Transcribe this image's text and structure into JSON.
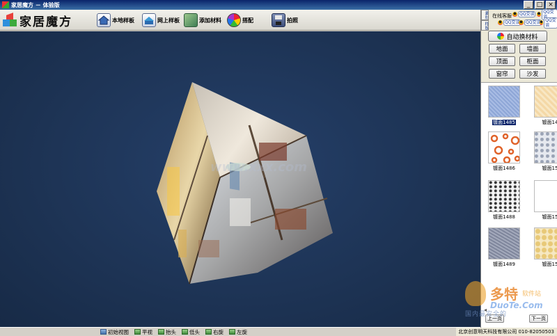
{
  "window": {
    "title": "家居魔方 － 体验版",
    "controls": [
      "_",
      "□",
      "×"
    ]
  },
  "toolbar": {
    "logo_text": "家居魔方",
    "buttons": [
      "本地样板",
      "网上样板",
      "添加材料",
      "搭配",
      "拍照"
    ]
  },
  "viewport": {
    "watermark": "www.xxx.com"
  },
  "bottombar": {
    "views": [
      "初始视图",
      "平视",
      "抬头",
      "低头",
      "右旋",
      "左旋"
    ]
  },
  "panel": {
    "vtabs": [
      "素材",
      "样板"
    ],
    "service_label": "在线客服",
    "qq_label": "QQ交谈",
    "auto_button": "自动换材料",
    "material_buttons": [
      "地面",
      "墙面",
      "顶面",
      "柜面",
      "窗帘",
      "沙发"
    ],
    "swatches": [
      {
        "label": "镀面1485",
        "selected": true,
        "color": "#8ea6d6"
      },
      {
        "label": "镀面14",
        "selected": false,
        "color": "#f4d8a6"
      },
      {
        "label": "镀面1486",
        "selected": false,
        "color": "#ffffff"
      },
      {
        "label": "镀面15",
        "selected": false,
        "color": "#dfe3ea"
      },
      {
        "label": "镀面1488",
        "selected": false,
        "color": "#f2f2f2"
      },
      {
        "label": "镀面15",
        "selected": false,
        "color": "#ffffff"
      },
      {
        "label": "镀面1489",
        "selected": false,
        "color": "#8d93a8"
      },
      {
        "label": "镀面15",
        "selected": false,
        "color": "#f3e1b0"
      }
    ],
    "nav_prev": "上一页",
    "nav_next": "下一页",
    "company": "北京创意明天科技有限公司  010-82050503"
  },
  "duote_watermark": {
    "big": "多特",
    "small": "软件站",
    "url": "DuoTe.Com",
    "cn": "国内最安全的"
  }
}
